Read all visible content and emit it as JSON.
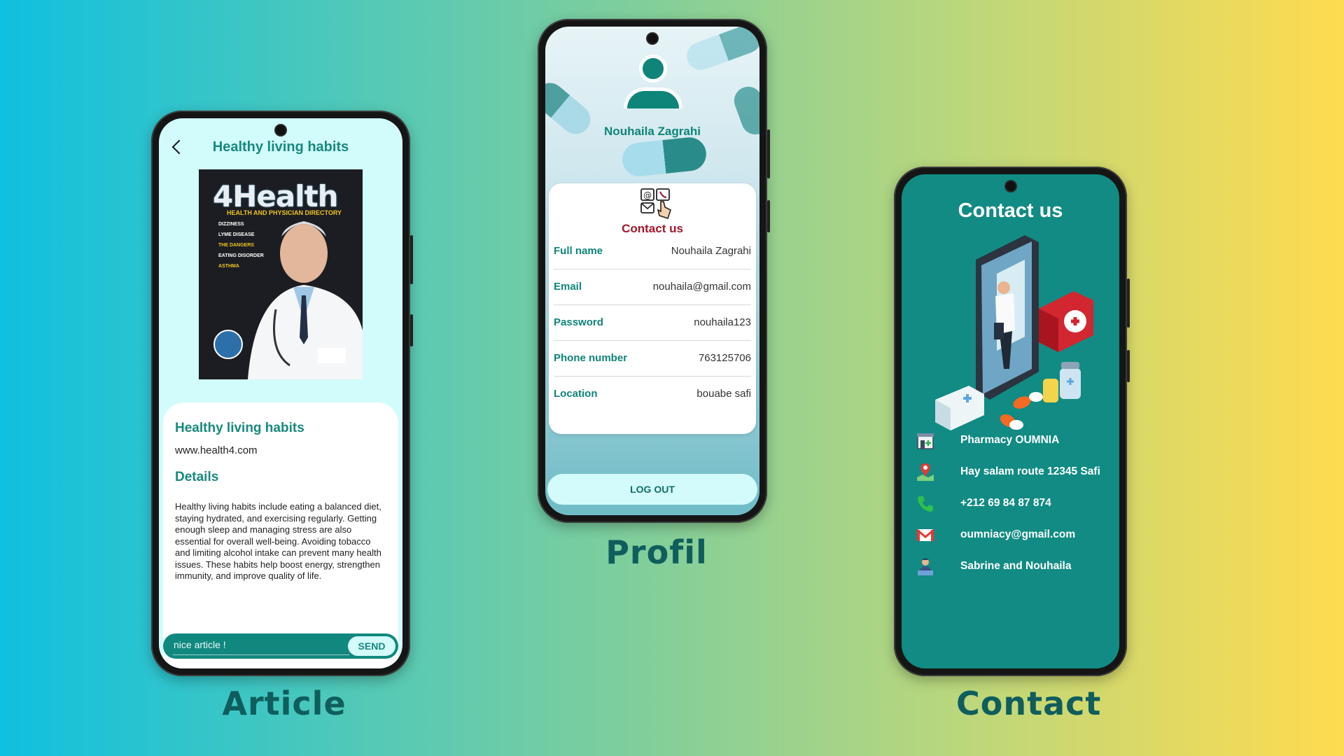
{
  "captions": {
    "article": "Article",
    "profile": "Profil",
    "contact": "Contact"
  },
  "article": {
    "title": "Healthy living habits",
    "magazine": {
      "logo": "4Health",
      "subtitle": "HEALTH AND PHYSICIAN DIRECTORY",
      "headlines": [
        "DIZZINESS",
        "LYME DISEASE",
        "THE DANGERS",
        "EATING DISORDER",
        "ASTHMA"
      ]
    },
    "card_title": "Healthy living habits",
    "url": "www.health4.com",
    "details_heading": "Details",
    "body": "Healthy living habits include eating a balanced diet, staying hydrated, and exercising regularly. Getting enough sleep and managing stress are also essential for overall well-being. Avoiding tobacco and limiting alcohol intake can prevent many health issues. These habits help boost energy, strengthen immunity, and improve quality of life.",
    "comment_value": "nice article !",
    "send_label": "SEND"
  },
  "profile": {
    "name": "Nouhaila Zagrahi",
    "contact_title": "Contact us",
    "fields": [
      {
        "label": "Full name",
        "value": "Nouhaila Zagrahi"
      },
      {
        "label": "Email",
        "value": "nouhaila@gmail.com"
      },
      {
        "label": "Password",
        "value": "nouhaila123"
      },
      {
        "label": "Phone number",
        "value": "763125706"
      },
      {
        "label": "Location",
        "value": "bouabe safi"
      }
    ],
    "logout_label": "LOG OUT"
  },
  "contact": {
    "title": "Contact us",
    "items": [
      {
        "icon": "pharmacy-icon",
        "text": "Pharmacy OUMNIA"
      },
      {
        "icon": "map-pin-icon",
        "text": "Hay salam route 12345 Safi"
      },
      {
        "icon": "phone-icon",
        "text": "+212 69 84 87 874"
      },
      {
        "icon": "mail-icon",
        "text": "oumniacy@gmail.com"
      },
      {
        "icon": "team-icon",
        "text": "Sabrine and Nouhaila"
      }
    ]
  },
  "colors": {
    "teal": "#118b83",
    "dark_teal": "#0f5d5d",
    "accent_red": "#a4162a",
    "light_cyan": "#d3fbfa"
  }
}
